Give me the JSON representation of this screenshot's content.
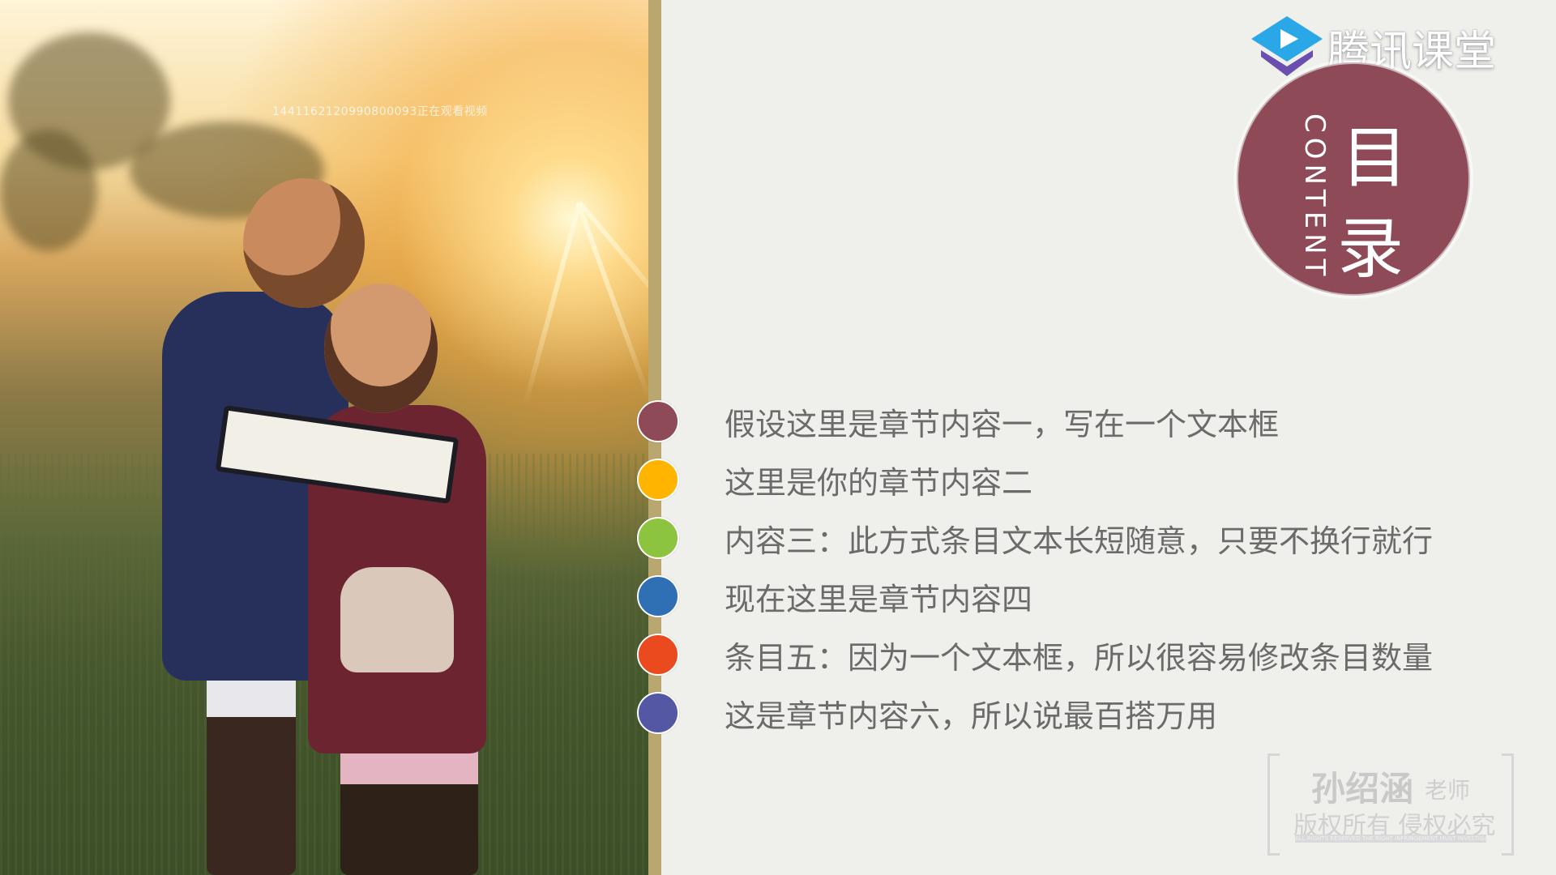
{
  "photo": {
    "viewer_watermark": "1441162120990800093正在观看视频"
  },
  "logo": {
    "text": "腾讯课堂",
    "icon": "play-triangle-logo-icon"
  },
  "heading": {
    "en": "CONTENT",
    "zh_line1": "目",
    "zh_line2": "录"
  },
  "toc": {
    "items": [
      {
        "label": "假设这里是章节内容一，写在一个文本框",
        "color": "#8e4a57"
      },
      {
        "label": "这里是你的章节内容二",
        "color": "#ffb400"
      },
      {
        "label": "内容三：此方式条目文本长短随意，只要不换行就行",
        "color": "#8cc43f"
      },
      {
        "label": "现在这里是章节内容四",
        "color": "#2f6fb3"
      },
      {
        "label": "条目五：因为一个文本框，所以很容易修改条目数量",
        "color": "#ea4a1e"
      },
      {
        "label": "这是章节内容六，所以说最百搭万用",
        "color": "#5457a3"
      }
    ]
  },
  "stamp": {
    "name": "孙绍涵",
    "title": "老师",
    "copyright": "版权所有 侵权必究",
    "tiny": "ALL RIGHTS RESERVED THE RIGHT INFRINGEMENT MUST INVESTIGATE"
  }
}
